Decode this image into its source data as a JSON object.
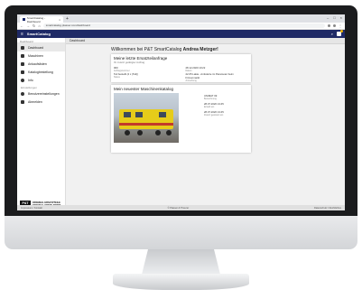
{
  "browser": {
    "tab_title": "SmartCatalog - Dashboard",
    "url": "smartcatalog.plasser.com/dashboard"
  },
  "app": {
    "title": "SmartCatalog"
  },
  "sidebar": {
    "header": "Dashboard",
    "items": [
      {
        "label": "Dashboard",
        "icon": "dashboard-icon"
      },
      {
        "label": "Maschinen",
        "icon": "machine-icon"
      },
      {
        "label": "Ankaufslisten",
        "icon": "list-icon"
      },
      {
        "label": "Katalogbestellung",
        "icon": "cart-icon"
      },
      {
        "label": "Info",
        "icon": "info-icon"
      }
    ],
    "section2": "Einstellungen",
    "items2": [
      {
        "label": "Benutzereinstellungen",
        "icon": "gear-icon"
      },
      {
        "label": "Abmelden",
        "icon": "logout-icon"
      }
    ],
    "brand_logo": "P&T",
    "brand_line1": "ORIGINAL ERSATZTEILE",
    "brand_line2": "ORIGINAL SPARE PARTS"
  },
  "breadcrumb": "Dashboard",
  "main": {
    "welcome_prefix": "Willkommen bei P&T SmartCatalog",
    "welcome_user": "Andrea Metzger!",
    "last_order": {
      "title": "Meine letzte Ersatzteilanfrage",
      "subtitle": "Ihr zuletzt getätigter Auftrag",
      "rows": [
        {
          "value": "000",
          "label": "Auftragsnummer"
        },
        {
          "value": "28.12.2020 10:22",
          "label": "Datum"
        },
        {
          "value": "Teil bestellt (4 x (Teil))",
          "label": "Status"
        },
        {
          "value": "22.05 Lakia - Anfoderte im Parameter beim Firmenmarkt",
          "label": "Anmerkung"
        }
      ]
    },
    "newest_catalog": {
      "title": "Mein neuester Maschinenkatalog",
      "details": [
        {
          "value": "UNIMAT 09",
          "label": "Bezeichnung"
        },
        {
          "value": "28.07.2020 13:45",
          "label": "Erstellt am"
        },
        {
          "value": "28.07.2020 13:45",
          "label": "Zuletzt geändert am"
        }
      ]
    }
  },
  "footer": {
    "left": "Impressum / Kontakt",
    "center": "© Plasser & Theurer",
    "right": "Datenschutz / Rechtliches"
  }
}
